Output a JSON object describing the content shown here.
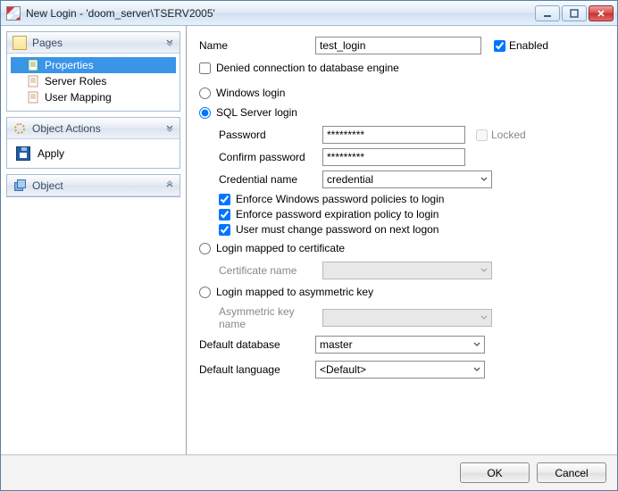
{
  "window": {
    "title": "New Login - 'doom_server\\TSERV2005'"
  },
  "sidebar": {
    "pages": {
      "title": "Pages",
      "items": [
        {
          "label": "Properties"
        },
        {
          "label": "Server Roles"
        },
        {
          "label": "User Mapping"
        }
      ]
    },
    "object_actions": {
      "title": "Object Actions",
      "apply": "Apply"
    },
    "object": {
      "title": "Object"
    }
  },
  "form": {
    "name_label": "Name",
    "name_value": "test_login",
    "enabled_label": "Enabled",
    "denied_label": "Denied connection to database engine",
    "windows_login_label": "Windows login",
    "sql_login_label": "SQL Server login",
    "password_label": "Password",
    "password_value": "*********",
    "confirm_label": "Confirm password",
    "confirm_value": "*********",
    "locked_label": "Locked",
    "credential_label": "Credential name",
    "credential_value": "credential",
    "enforce_win_label": "Enforce Windows password policies to login",
    "enforce_exp_label": "Enforce password expiration policy to login",
    "must_change_label": "User must change password on next logon",
    "cert_login_label": "Login mapped to certificate",
    "cert_name_label": "Certificate name",
    "asym_login_label": "Login mapped to asymmetric key",
    "asym_name_label": "Asymmetric key name",
    "default_db_label": "Default database",
    "default_db_value": "master",
    "default_lang_label": "Default language",
    "default_lang_value": "<Default>"
  },
  "footer": {
    "ok": "OK",
    "cancel": "Cancel"
  }
}
